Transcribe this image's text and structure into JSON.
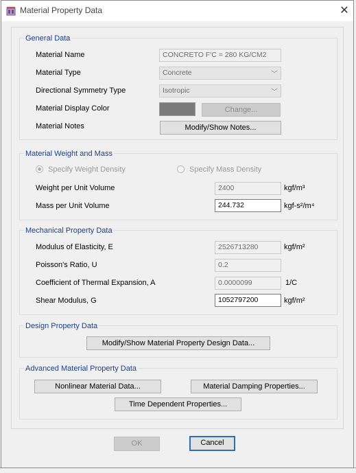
{
  "window": {
    "title": "Material Property Data",
    "close_glyph": "✕"
  },
  "general": {
    "title": "General Data",
    "material_name_label": "Material Name",
    "material_name_value": "CONCRETO F'C = 280 KG/CM2",
    "material_type_label": "Material Type",
    "material_type_value": "Concrete",
    "symmetry_label": "Directional Symmetry Type",
    "symmetry_value": "Isotropic",
    "color_label": "Material Display Color",
    "color_value": "#7a7a7a",
    "change_button": "Change...",
    "notes_label": "Material Notes",
    "notes_button": "Modify/Show Notes..."
  },
  "weight": {
    "title": "Material Weight and Mass",
    "radio_weight": "Specify Weight Density",
    "radio_mass": "Specify Mass Density",
    "weight_label": "Weight per Unit Volume",
    "weight_value": "2400",
    "weight_unit": "kgf/m³",
    "mass_label": "Mass per Unit Volume",
    "mass_value": "244.732",
    "mass_unit": "kgf-s²/m⁴"
  },
  "mechanical": {
    "title": "Mechanical Property Data",
    "modulus_label": "Modulus of Elasticity,  E",
    "modulus_value": "2526713280",
    "modulus_unit": "kgf/m²",
    "poisson_label": "Poisson's Ratio,  U",
    "poisson_value": "0.2",
    "thermal_label": "Coefficient of Thermal Expansion,  A",
    "thermal_value": "0.0000099",
    "thermal_unit": "1/C",
    "shear_label": "Shear Modulus,  G",
    "shear_value": "1052797200",
    "shear_unit": "kgf/m²"
  },
  "design": {
    "title": "Design Property Data",
    "button": "Modify/Show Material Property Design Data..."
  },
  "advanced": {
    "title": "Advanced Material Property Data",
    "nonlinear_button": "Nonlinear Material Data...",
    "damping_button": "Material Damping Properties...",
    "time_button": "Time Dependent Properties..."
  },
  "footer": {
    "ok_button": "OK",
    "cancel_button": "Cancel"
  }
}
